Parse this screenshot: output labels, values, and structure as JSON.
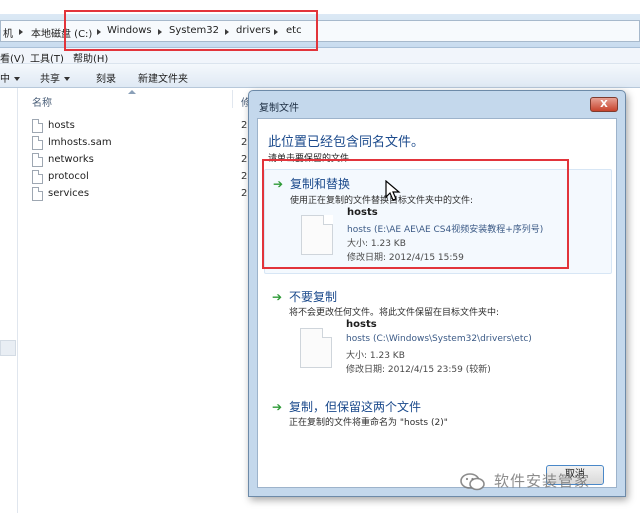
{
  "address_bar": {
    "crumbs": [
      "机",
      "本地磁盘 (C:)",
      "Windows",
      "System32",
      "drivers",
      "etc"
    ]
  },
  "menubar": {
    "items": [
      "看(V)",
      "工具(T)",
      "帮助(H)"
    ]
  },
  "toolbar": {
    "items": [
      "中",
      "共享",
      "刻录",
      "新建文件夹"
    ]
  },
  "file_list": {
    "columns": {
      "name": "名称",
      "date": "修"
    },
    "files": [
      {
        "name": "hosts",
        "date": "2"
      },
      {
        "name": "lmhosts.sam",
        "date": "2"
      },
      {
        "name": "networks",
        "date": "2"
      },
      {
        "name": "protocol",
        "date": "2"
      },
      {
        "name": "services",
        "date": "2"
      }
    ]
  },
  "dialog": {
    "title": "复制文件",
    "close_label": "X",
    "heading": "此位置已经包含同名文件。",
    "subheading": "请单击要保留的文件",
    "options": [
      {
        "title": "复制和替换",
        "desc": "使用正在复制的文件替换目标文件夹中的文件:",
        "file_name": "hosts",
        "file_path": "hosts (E:\\AE AE\\AE CS4视频安装教程+序列号)",
        "file_size": "大小: 1.23 KB",
        "file_date": "修改日期: 2012/4/15 15:59"
      },
      {
        "title": "不要复制",
        "desc": "将不会更改任何文件。将此文件保留在目标文件夹中:",
        "file_name": "hosts",
        "file_path": "hosts (C:\\Windows\\System32\\drivers\\etc)",
        "file_size": "大小: 1.23 KB",
        "file_date": "修改日期: 2012/4/15 23:59 (较新)"
      },
      {
        "title": "复制，但保留这两个文件",
        "desc": "正在复制的文件将重命名为 \"hosts (2)\""
      }
    ],
    "cancel_label": "取消"
  },
  "watermark": {
    "text": "软件安装管家"
  },
  "colors": {
    "highlight_box": "#e2343b",
    "link_blue": "#1b4a8c",
    "green_arrow": "#2f9b38"
  }
}
